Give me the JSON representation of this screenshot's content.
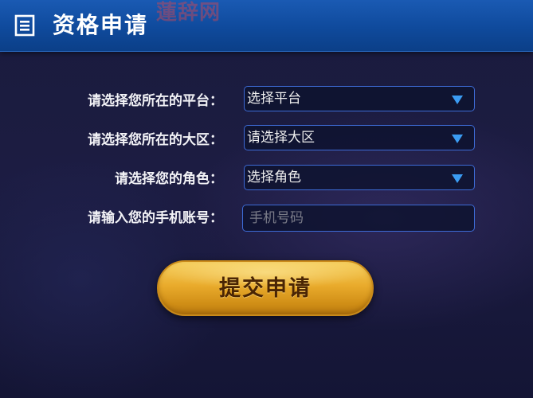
{
  "header": {
    "icon": "document-list-icon",
    "title": "资格申请",
    "watermark": "蓮辞网"
  },
  "form": {
    "platform": {
      "label": "请选择您所在的平台：",
      "value": "选择平台",
      "icon": "dropdown-arrow-icon"
    },
    "region": {
      "label": "请选择您所在的大区：",
      "value": "请选择大区",
      "icon": "dropdown-arrow-icon"
    },
    "role": {
      "label": "请选择您的角色：",
      "value": "选择角色",
      "icon": "dropdown-arrow-icon"
    },
    "phone": {
      "label": "请输入您的手机账号：",
      "value": "",
      "placeholder": "手机号码"
    },
    "submit_label": "提交申请"
  },
  "colors": {
    "header_blue": "#0f4a9c",
    "field_border": "#3d6bd6",
    "arrow_blue": "#3b9cf3",
    "button_gold": "#e9ab2c",
    "button_text": "#4a2504"
  }
}
